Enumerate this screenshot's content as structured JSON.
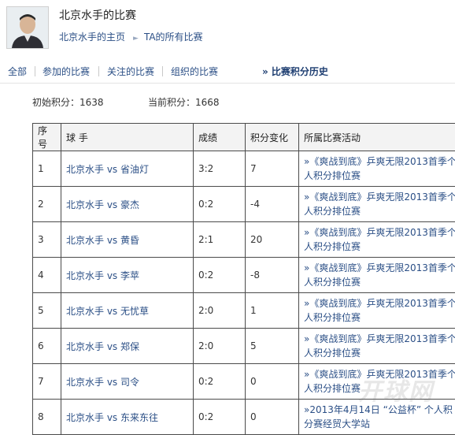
{
  "header": {
    "title": "北京水手的比赛",
    "breadcrumb": [
      "北京水手的主页",
      "TA的所有比赛"
    ]
  },
  "nav": {
    "tabs": [
      "全部",
      "参加的比赛",
      "关注的比赛",
      "组织的比赛"
    ],
    "active": "» 比赛积分历史"
  },
  "scores": {
    "initial_label": "初始积分：",
    "initial_value": "1638",
    "current_label": "当前积分：",
    "current_value": "1668"
  },
  "table": {
    "headers": [
      "序号",
      "球 手",
      "成绩",
      "积分变化",
      "所属比赛活动"
    ],
    "rows": [
      {
        "no": "1",
        "player": "北京水手  vs 省油灯",
        "result": "3:2",
        "change": "7",
        "event": "»《爽战到底》乒爽无限2013首季个人积分排位赛"
      },
      {
        "no": "2",
        "player": "北京水手  vs 豪杰",
        "result": "0:2",
        "change": "-4",
        "event": "»《爽战到底》乒爽无限2013首季个人积分排位赛"
      },
      {
        "no": "3",
        "player": "北京水手  vs 黄昏",
        "result": "2:1",
        "change": "20",
        "event": "»《爽战到底》乒爽无限2013首季个人积分排位赛"
      },
      {
        "no": "4",
        "player": "北京水手  vs 李苹",
        "result": "0:2",
        "change": "-8",
        "event": "»《爽战到底》乒爽无限2013首季个人积分排位赛"
      },
      {
        "no": "5",
        "player": "北京水手  vs 无忧草",
        "result": "2:0",
        "change": "1",
        "event": "»《爽战到底》乒爽无限2013首季个人积分排位赛"
      },
      {
        "no": "6",
        "player": "北京水手  vs 郑保",
        "result": "2:0",
        "change": "5",
        "event": "»《爽战到底》乒爽无限2013首季个人积分排位赛"
      },
      {
        "no": "7",
        "player": "北京水手  vs 司令",
        "result": "0:2",
        "change": "0",
        "event": "»《爽战到底》乒爽无限2013首季个人积分排位赛"
      },
      {
        "no": "8",
        "player": "北京水手  vs 东来东往",
        "result": "0:2",
        "change": "0",
        "event": "»2013年4月14日 “公益杯” 个人积分赛经贸大学站"
      }
    ]
  },
  "watermark": "开球网"
}
